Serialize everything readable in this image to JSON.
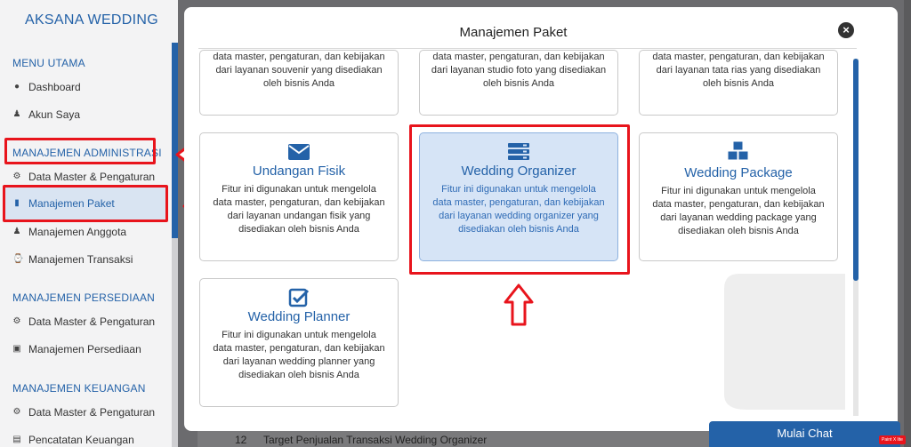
{
  "sidebar": {
    "brand": "AKSANA WEDDING",
    "sections": [
      {
        "label": "MENU UTAMA"
      },
      {
        "label": "MANAJEMEN ADMINISTRASI"
      },
      {
        "label": "MANAJEMEN PERSEDIAAN"
      },
      {
        "label": "MANAJEMEN KEUANGAN"
      }
    ],
    "items": [
      {
        "label": "Dashboard",
        "icon": "globe-icon"
      },
      {
        "label": "Akun Saya",
        "icon": "user-icon"
      },
      {
        "label": "Data Master & Pengaturan",
        "icon": "gears-icon"
      },
      {
        "label": "Manajemen Paket",
        "icon": "book-icon"
      },
      {
        "label": "Manajemen Anggota",
        "icon": "users-icon"
      },
      {
        "label": "Manajemen Transaksi",
        "icon": "cart-icon"
      },
      {
        "label": "Data Master & Pengaturan",
        "icon": "gears-icon"
      },
      {
        "label": "Manajemen Persediaan",
        "icon": "cubes-icon"
      },
      {
        "label": "Data Master & Pengaturan",
        "icon": "gears-icon"
      },
      {
        "label": "Pencatatan Keuangan",
        "icon": "money-icon"
      }
    ]
  },
  "modal": {
    "title": "Manajemen Paket",
    "cards": [
      {
        "title": "",
        "desc": "data master, pengaturan, dan kebijakan dari layanan souvenir yang disediakan oleh bisnis Anda",
        "icon": ""
      },
      {
        "title": "",
        "desc": "data master, pengaturan, dan kebijakan dari layanan studio foto yang disediakan oleh bisnis Anda",
        "icon": ""
      },
      {
        "title": "",
        "desc": "data master, pengaturan, dan kebijakan dari layanan tata rias yang disediakan oleh bisnis Anda",
        "icon": ""
      },
      {
        "title": "Undangan Fisik",
        "desc": "Fitur ini digunakan untuk mengelola data master, pengaturan, dan kebijakan dari layanan undangan fisik yang disediakan oleh bisnis Anda",
        "icon": "envelope-icon"
      },
      {
        "title": "Wedding Organizer",
        "desc": "Fitur ini digunakan untuk mengelola data master, pengaturan, dan kebijakan dari layanan wedding organizer yang disediakan oleh bisnis Anda",
        "icon": "server-icon"
      },
      {
        "title": "Wedding Package",
        "desc": "Fitur ini digunakan untuk mengelola data master, pengaturan, dan kebijakan dari layanan wedding package yang disediakan oleh bisnis Anda",
        "icon": "cubes-icon"
      },
      {
        "title": "Wedding Planner",
        "desc": "Fitur ini digunakan untuk mengelola data master, pengaturan, dan kebijakan dari layanan wedding planner yang disediakan oleh bisnis Anda",
        "icon": "check-square-icon"
      }
    ]
  },
  "background_table": {
    "row_number": "12",
    "row_text": "Target Penjualan Transaksi Wedding Organizer"
  },
  "chat": {
    "label": "Mulai Chat"
  },
  "badge": {
    "label": "Paint X lite"
  },
  "colors": {
    "accent": "#2462a8",
    "highlight": "#e8141c",
    "card_active_bg": "#d6e4f6"
  }
}
